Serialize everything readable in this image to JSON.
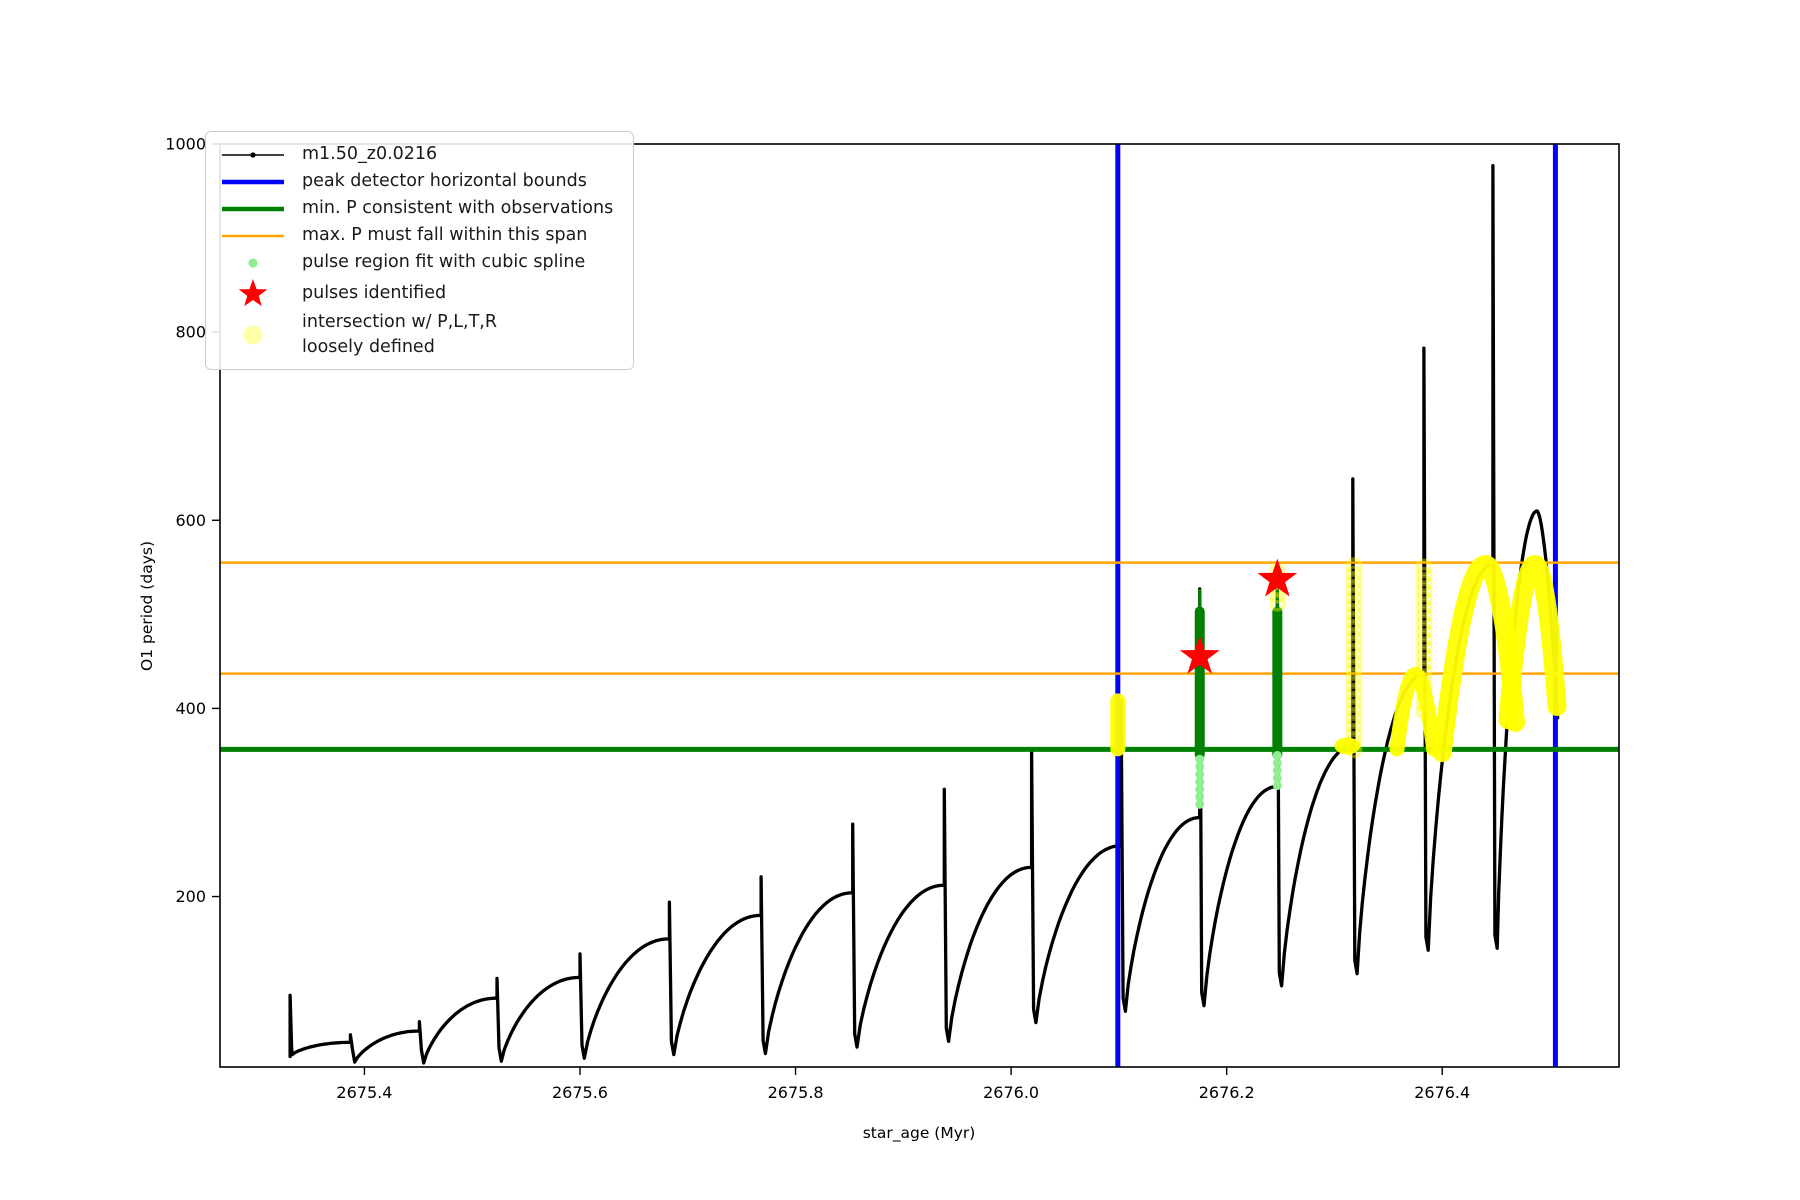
{
  "colors": {
    "black": "#000000",
    "blue": "#0000ff",
    "green": "#008000",
    "orange": "#ffa500",
    "lightgreen": "#90ee90",
    "red": "#ff0000",
    "yellow": "#ffff00",
    "paleyellow": "rgba(255,255,0,0.34)",
    "ring": "rgba(255,255,0,0.40)",
    "spine": "#000000"
  },
  "chart_data": {
    "type": "line",
    "title": "",
    "xlabel": "star_age (Myr)",
    "ylabel": "O1 period (days)",
    "xlim": [
      2675.266,
      2676.564
    ],
    "ylim": [
      18.8,
      1000
    ],
    "grid": false,
    "legend_position": "upper-left",
    "x_ticks": [
      {
        "v": 2675.4,
        "label": "2675.4"
      },
      {
        "v": 2675.6,
        "label": "2675.6"
      },
      {
        "v": 2675.8,
        "label": "2675.8"
      },
      {
        "v": 2676.0,
        "label": "2676.0"
      },
      {
        "v": 2676.2,
        "label": "2676.2"
      },
      {
        "v": 2676.4,
        "label": "2676.4"
      }
    ],
    "y_ticks": [
      {
        "v": 200,
        "label": "200"
      },
      {
        "v": 400,
        "label": "400"
      },
      {
        "v": 600,
        "label": "600"
      },
      {
        "v": 800,
        "label": "800"
      },
      {
        "v": 1000,
        "label": "1000"
      }
    ],
    "series_name": "m1.50_z0.0216",
    "peak_detector_bounds_x": [
      2676.099,
      2676.505
    ],
    "min_P_line": 356.5,
    "max_P_span": [
      437,
      555
    ],
    "initial_blob": {
      "x": 2675.331,
      "from": 30,
      "to": 95
    },
    "cycles": [
      {
        "start": 2675.333,
        "low": 32,
        "spike_x": 2675.387,
        "shoulder": 45,
        "peak": 53
      },
      {
        "start": 2675.391,
        "low": 24,
        "spike_x": 2675.451,
        "shoulder": 57,
        "peak": 67
      },
      {
        "start": 2675.455,
        "low": 23,
        "spike_x": 2675.523,
        "shoulder": 92,
        "peak": 113
      },
      {
        "start": 2675.527,
        "low": 25,
        "spike_x": 2675.6,
        "shoulder": 114,
        "peak": 139
      },
      {
        "start": 2675.604,
        "low": 28,
        "spike_x": 2675.683,
        "shoulder": 155,
        "peak": 194
      },
      {
        "start": 2675.687,
        "low": 32,
        "spike_x": 2675.768,
        "shoulder": 180,
        "peak": 221
      },
      {
        "start": 2675.772,
        "low": 33,
        "spike_x": 2675.853,
        "shoulder": 204,
        "peak": 277
      },
      {
        "start": 2675.857,
        "low": 40,
        "spike_x": 2675.938,
        "shoulder": 212,
        "peak": 314
      },
      {
        "start": 2675.942,
        "low": 46,
        "spike_x": 2676.019,
        "shoulder": 231,
        "peak": 355
      },
      {
        "start": 2676.023,
        "low": 66,
        "spike_x": 2676.102,
        "shoulder": 254,
        "peak": 408
      },
      {
        "start": 2676.106,
        "low": 78,
        "spike_x": 2676.175,
        "shoulder": 284,
        "peak": 527
      },
      {
        "start": 2676.179,
        "low": 84,
        "spike_x": 2676.247,
        "shoulder": 317,
        "peak": 547
      },
      {
        "start": 2676.251,
        "low": 105,
        "spike_x": 2676.317,
        "shoulder": 360,
        "peak": 644
      },
      {
        "start": 2676.321,
        "low": 118,
        "spike_x": 2676.383,
        "shoulder": 436,
        "peak": 783
      },
      {
        "start": 2676.387,
        "low": 143,
        "spike_x": 2676.447,
        "shoulder": 553,
        "peak": 977
      }
    ],
    "final_hump": {
      "start": 2676.451,
      "low": 145,
      "peak_x": 2676.488,
      "peak": 610,
      "end_x": 2676.507,
      "end": 390
    },
    "green_columns": [
      {
        "x": 2676.175,
        "thick_from": 351,
        "thick_to": 503,
        "thin_to": 527
      },
      {
        "x": 2676.247,
        "thick_from": 351,
        "thick_to": 503,
        "thin_to": 540
      }
    ],
    "lightgreen_dots": [
      {
        "x": 2676.175,
        "values": [
          298,
          306,
          314,
          322,
          330,
          338,
          346
        ]
      },
      {
        "x": 2676.247,
        "values": [
          318,
          326,
          334,
          342,
          350
        ]
      }
    ],
    "pulses_identified": [
      {
        "x": 2676.175,
        "y": 455
      },
      {
        "x": 2676.247,
        "y": 537
      }
    ],
    "yellow_solid_column": {
      "x": 2676.099,
      "from": 357,
      "to": 408
    },
    "yellow_blob": {
      "x": 2676.312,
      "y": 360,
      "rx_myr": 0.012,
      "ry_days": 9
    },
    "yellow_ring_columns": [
      {
        "x": 2676.318,
        "from": 356,
        "to": 556,
        "step_days": 8.5
      },
      {
        "x": 2676.383,
        "from": 397,
        "to": 555,
        "step_days": 8.5
      },
      {
        "x": 2676.247,
        "from": 512,
        "to": 548,
        "step_days": 8.5
      }
    ],
    "yellow_arcs": [
      {
        "x1": 2676.358,
        "y1": 357,
        "peak_x": 2676.375,
        "peak": 436,
        "x2": 2676.392,
        "y2": 357,
        "w": 15
      },
      {
        "x1": 2676.4,
        "y1": 353,
        "peak_x": 2676.44,
        "peak": 553,
        "x2": 2676.468,
        "y2": 385,
        "w": 19
      },
      {
        "x1": 2676.461,
        "y1": 388,
        "peak_x": 2676.486,
        "peak": 553,
        "x2": 2676.5065,
        "y2": 402,
        "w": 19
      }
    ]
  },
  "legend": {
    "entries": [
      {
        "marker": "line-dot",
        "color": "black",
        "label": "m1.50_z0.0216"
      },
      {
        "marker": "thick-line",
        "color": "blue",
        "label": "peak detector horizontal bounds"
      },
      {
        "marker": "thick-line",
        "color": "green",
        "label": "min. P consistent with observations"
      },
      {
        "marker": "line",
        "color": "orange",
        "label": "max. P must fall within this span"
      },
      {
        "marker": "dot-small",
        "color": "lightgreen",
        "label": "pulse region fit with cubic spline"
      },
      {
        "marker": "star",
        "color": "red",
        "label": "pulses identified"
      },
      {
        "marker": "dot-big",
        "color": "paleyellow",
        "label": "intersection w/ P,L,T,R\nloosely defined"
      }
    ]
  }
}
